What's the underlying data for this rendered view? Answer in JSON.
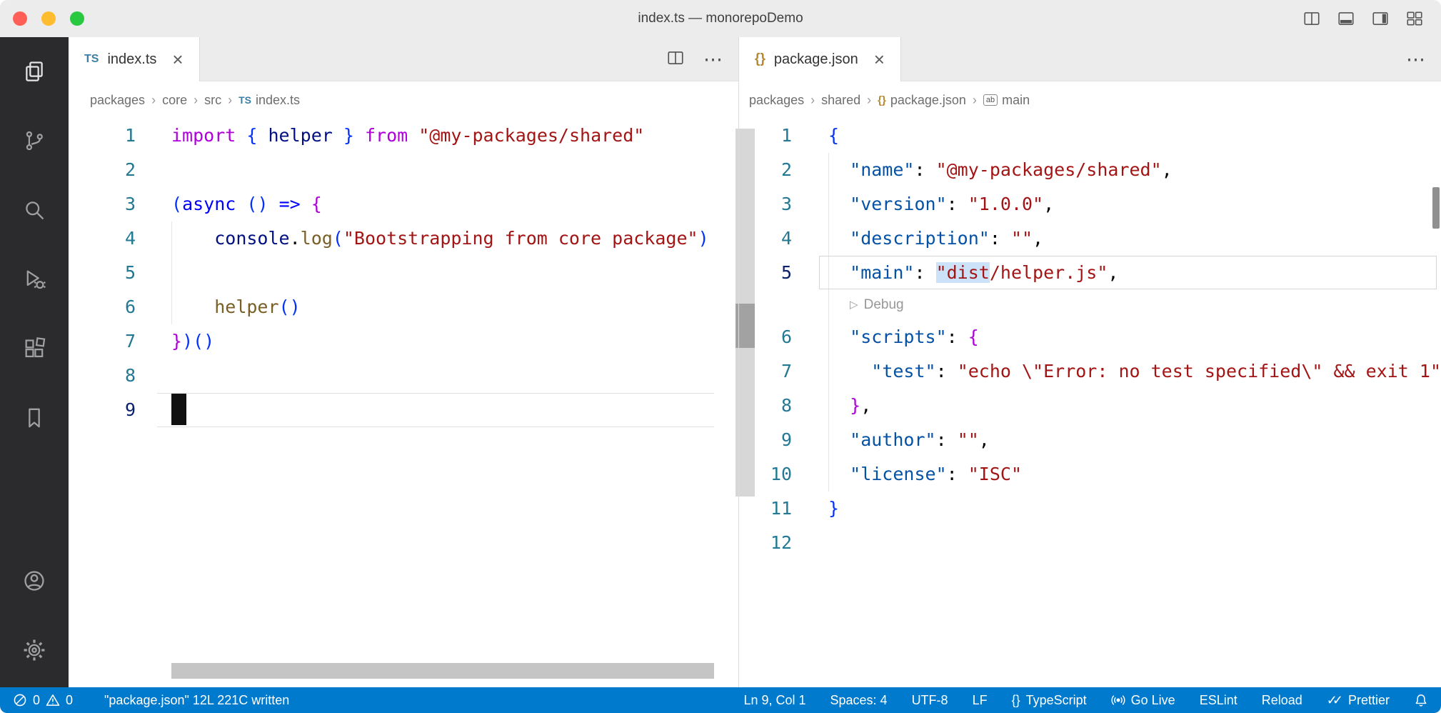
{
  "window": {
    "title": "index.ts — monorepoDemo"
  },
  "icons": {
    "close": "×",
    "more": "⋯",
    "crumb_separator": "›",
    "codelens_play": "▷",
    "ts_badge": "TS",
    "json_badge": "{}",
    "braces": "{}",
    "double_check": "✓✓",
    "symbol_main": "ab"
  },
  "activity_bar": {
    "items": [
      "explorer",
      "source-control",
      "search",
      "run-and-debug",
      "extensions",
      "bookmarks"
    ],
    "bottom_items": [
      "account",
      "settings"
    ]
  },
  "left_editor": {
    "tab_label": "index.ts",
    "breadcrumbs": [
      {
        "label": "packages"
      },
      {
        "label": "core"
      },
      {
        "label": "src"
      },
      {
        "label": "index.ts",
        "icon": "ts"
      }
    ],
    "lines": [
      {
        "n": 1,
        "t": [
          [
            "import ",
            "kw"
          ],
          [
            "{",
            "brk"
          ],
          [
            " ",
            "pln"
          ],
          [
            "helper",
            "var"
          ],
          [
            " ",
            "pln"
          ],
          [
            "}",
            "brk"
          ],
          [
            " ",
            "pln"
          ],
          [
            "from ",
            "kw"
          ],
          [
            "\"@my-packages/shared\"",
            "str"
          ]
        ]
      },
      {
        "n": 2,
        "t": []
      },
      {
        "n": 3,
        "t": [
          [
            "(",
            "brk"
          ],
          [
            "async",
            "kw2"
          ],
          [
            " ",
            "pln"
          ],
          [
            "()",
            "brk"
          ],
          [
            " ",
            "pln"
          ],
          [
            "=>",
            "kw2"
          ],
          [
            " ",
            "pln"
          ],
          [
            "{",
            "brk2"
          ]
        ]
      },
      {
        "n": 4,
        "t": [
          [
            "    ",
            "pln"
          ],
          [
            "console",
            "var"
          ],
          [
            ".",
            "pln"
          ],
          [
            "log",
            "fn"
          ],
          [
            "(",
            "brk"
          ],
          [
            "\"Bootstrapping from core package\"",
            "str"
          ],
          [
            ")",
            "brk"
          ]
        ]
      },
      {
        "n": 5,
        "t": []
      },
      {
        "n": 6,
        "t": [
          [
            "    ",
            "pln"
          ],
          [
            "helper",
            "fn"
          ],
          [
            "()",
            "brk"
          ]
        ]
      },
      {
        "n": 7,
        "t": [
          [
            "}",
            "brk2"
          ],
          [
            ")()",
            "brk"
          ]
        ]
      },
      {
        "n": 8,
        "t": []
      },
      {
        "n": 9,
        "t": [],
        "cursor": true,
        "current": true
      }
    ]
  },
  "right_editor": {
    "tab_label": "package.json",
    "breadcrumbs": [
      {
        "label": "packages"
      },
      {
        "label": "shared"
      },
      {
        "label": "package.json",
        "icon": "json"
      },
      {
        "label": "main",
        "icon": "symbol"
      }
    ],
    "lines": [
      {
        "n": 1,
        "t": [
          [
            "{",
            "brk"
          ]
        ]
      },
      {
        "n": 2,
        "t": [
          [
            "  ",
            "pln"
          ],
          [
            "\"name\"",
            "key"
          ],
          [
            ": ",
            "pln"
          ],
          [
            "\"@my-packages/shared\"",
            "str"
          ],
          [
            ",",
            "pln"
          ]
        ]
      },
      {
        "n": 3,
        "t": [
          [
            "  ",
            "pln"
          ],
          [
            "\"version\"",
            "key"
          ],
          [
            ": ",
            "pln"
          ],
          [
            "\"1.0.0\"",
            "str"
          ],
          [
            ",",
            "pln"
          ]
        ]
      },
      {
        "n": 4,
        "t": [
          [
            "  ",
            "pln"
          ],
          [
            "\"description\"",
            "key"
          ],
          [
            ": ",
            "pln"
          ],
          [
            "\"\"",
            "str"
          ],
          [
            ",",
            "pln"
          ]
        ]
      },
      {
        "n": 5,
        "t": [
          [
            "  ",
            "pln"
          ],
          [
            "\"main\"",
            "key"
          ],
          [
            ": ",
            "pln"
          ],
          [
            "\"dist",
            "strh"
          ],
          [
            "/helper.js\"",
            "str"
          ],
          [
            ",",
            "pln"
          ]
        ],
        "current": true
      },
      {
        "lens": "Debug"
      },
      {
        "n": 6,
        "t": [
          [
            "  ",
            "pln"
          ],
          [
            "\"scripts\"",
            "key"
          ],
          [
            ": ",
            "pln"
          ],
          [
            "{",
            "brk2"
          ]
        ]
      },
      {
        "n": 7,
        "t": [
          [
            "    ",
            "pln"
          ],
          [
            "\"test\"",
            "key"
          ],
          [
            ": ",
            "pln"
          ],
          [
            "\"echo \\\"Error: no test specified\\\" && exit 1\"",
            "str"
          ]
        ]
      },
      {
        "n": 8,
        "t": [
          [
            "  ",
            "pln"
          ],
          [
            "}",
            "brk2"
          ],
          [
            ",",
            "pln"
          ]
        ]
      },
      {
        "n": 9,
        "t": [
          [
            "  ",
            "pln"
          ],
          [
            "\"author\"",
            "key"
          ],
          [
            ": ",
            "pln"
          ],
          [
            "\"\"",
            "str"
          ],
          [
            ",",
            "pln"
          ]
        ]
      },
      {
        "n": 10,
        "t": [
          [
            "  ",
            "pln"
          ],
          [
            "\"license\"",
            "key"
          ],
          [
            ": ",
            "pln"
          ],
          [
            "\"ISC\"",
            "str"
          ]
        ]
      },
      {
        "n": 11,
        "t": [
          [
            "}",
            "brk"
          ]
        ]
      },
      {
        "n": 12,
        "t": []
      }
    ]
  },
  "status_bar": {
    "errors": "0",
    "warnings": "0",
    "message": "\"package.json\" 12L 221C written",
    "cursor_position": "Ln 9, Col 1",
    "indentation": "Spaces: 4",
    "encoding": "UTF-8",
    "eol": "LF",
    "language": "TypeScript",
    "go_live": "Go Live",
    "eslint": "ESLint",
    "reload": "Reload",
    "prettier": "Prettier"
  },
  "colors": {
    "status_bar": "#007acc",
    "activity_bar": "#2b2b2d",
    "keyword": "#af00db",
    "string": "#a31515",
    "json_key": "#0451a5"
  }
}
